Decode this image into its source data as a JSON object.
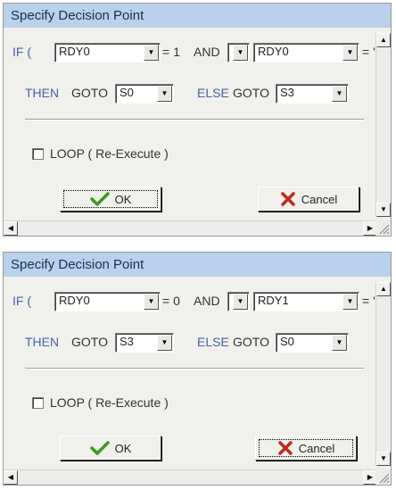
{
  "dialogs": [
    {
      "title": "Specify Decision Point",
      "if_label": "IF (",
      "cond1": "RDY0",
      "op1": "= 1",
      "and_label": "AND",
      "cond2": "RDY0",
      "op2": "= '",
      "then_label": "THEN",
      "goto1": "GOTO",
      "then_target": "S0",
      "else_label": "ELSE",
      "goto2": "GOTO",
      "else_target": "S3",
      "loop_label": "LOOP ( Re-Execute )",
      "ok_label": "OK",
      "cancel_label": "Cancel",
      "focused_button": "ok"
    },
    {
      "title": "Specify Decision Point",
      "if_label": "IF (",
      "cond1": "RDY0",
      "op1": "= 0",
      "and_label": "AND",
      "cond2": "RDY1",
      "op2": "= '",
      "then_label": "THEN",
      "goto1": "GOTO",
      "then_target": "S3",
      "else_label": "ELSE",
      "goto2": "GOTO",
      "else_target": "S0",
      "loop_label": "LOOP ( Re-Execute )",
      "ok_label": "OK",
      "cancel_label": "Cancel",
      "focused_button": "cancel"
    }
  ],
  "icons": {
    "dropdown": "triangle-down",
    "ok": "green-checkmark",
    "cancel": "red-x"
  },
  "colors": {
    "titlebar": "#b9d1ea",
    "keyword": "#4762a8",
    "ok_icon": "#3a9a1c",
    "cancel_icon": "#c0281e"
  }
}
